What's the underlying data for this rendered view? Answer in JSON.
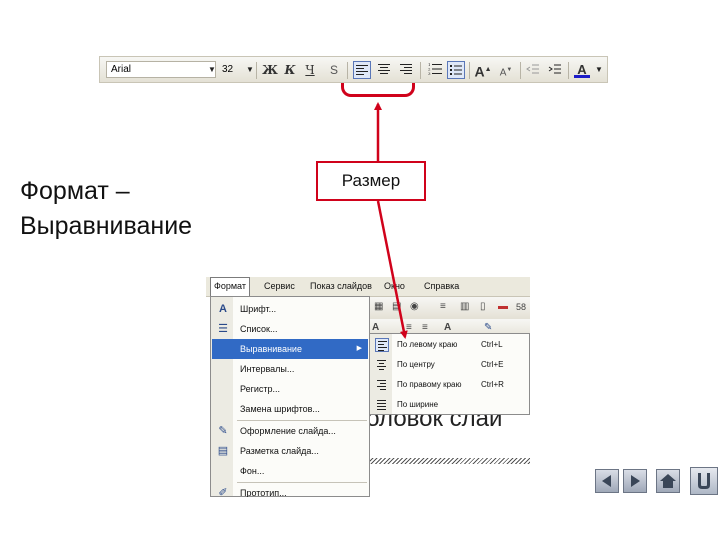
{
  "toolbar": {
    "font_name": "Arial",
    "font_size": "32",
    "buttons": [
      "bold-icon",
      "italic-icon",
      "underline-icon",
      "shadow-icon",
      "align-left-icon",
      "align-center-icon",
      "align-right-icon",
      "numbering-icon",
      "bullets-icon",
      "increase-font-icon",
      "decrease-font-icon",
      "decrease-indent-icon",
      "increase-indent-icon",
      "font-color-icon"
    ],
    "font_color": "#1c1cc8"
  },
  "slide": {
    "title_line1": "Формат –",
    "title_line2": "Выравнивание",
    "callout": "Размер",
    "accent_color": "#d0021b"
  },
  "menubar": {
    "items": [
      "Формат",
      "Сервис",
      "Показ слайдов",
      "Окно",
      "Справка"
    ]
  },
  "format_menu": {
    "items": [
      {
        "label": "Шрифт...",
        "icon": "font-a-icon"
      },
      {
        "label": "Список...",
        "icon": "list-icon"
      },
      {
        "label": "Выравнивание",
        "icon": "",
        "highlighted": true,
        "submenu_arrow": "▶"
      },
      {
        "label": "Интервалы...",
        "icon": ""
      },
      {
        "label": "Регистр...",
        "icon": ""
      },
      {
        "label": "Замена шрифтов...",
        "icon": ""
      },
      {
        "label": "Оформление слайда...",
        "icon": "slide-design-icon"
      },
      {
        "label": "Разметка слайда...",
        "icon": "slide-layout-icon"
      },
      {
        "label": "Фон...",
        "icon": ""
      },
      {
        "label": "Прототип...",
        "icon": "prototype-icon"
      }
    ]
  },
  "align_submenu": {
    "items": [
      {
        "label": "По левому краю",
        "shortcut": "Ctrl+L"
      },
      {
        "label": "По центру",
        "shortcut": "Ctrl+E"
      },
      {
        "label": "По правому краю",
        "shortcut": "Ctrl+R"
      },
      {
        "label": "По ширине",
        "shortcut": ""
      }
    ]
  },
  "background": {
    "zoom_partial": "58",
    "slide_text_partial": "головок слай"
  },
  "nav_buttons": [
    "prev-slide-icon",
    "next-slide-icon",
    "home-icon",
    "return-icon"
  ]
}
